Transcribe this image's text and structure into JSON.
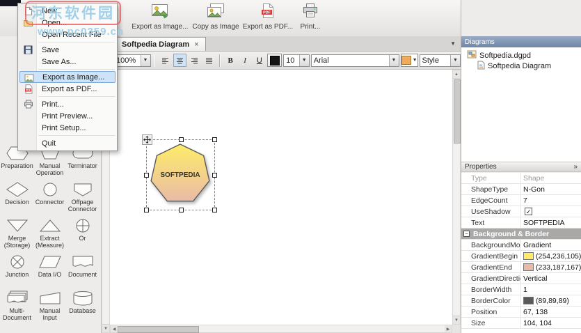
{
  "icons": {
    "dropdown_arrow": "▼",
    "close": "×",
    "check": "✓",
    "chevron_right": "»",
    "collapse": "−",
    "arrow_up": "▲",
    "arrow_down": "▼",
    "arrow_left": "◀",
    "arrow_right": "▶"
  },
  "watermark": {
    "line1": "河东软件园",
    "line2": "www.pc0359.cn"
  },
  "toolbar": {
    "buttons": [
      {
        "label": "Export as Image..."
      },
      {
        "label": "Copy as Image"
      },
      {
        "label": "Export as PDF..."
      },
      {
        "label": "Print..."
      }
    ]
  },
  "file_menu": {
    "items": [
      {
        "label": "New"
      },
      {
        "label": "Open..."
      },
      {
        "label": "Open Recent File"
      },
      {
        "label": "Save"
      },
      {
        "label": "Save As..."
      },
      {
        "label": "Export as Image..."
      },
      {
        "label": "Export as PDF..."
      },
      {
        "label": "Print..."
      },
      {
        "label": "Print Preview..."
      },
      {
        "label": "Print Setup..."
      },
      {
        "label": "Quit"
      }
    ]
  },
  "tabbar": {
    "active_tab": "Softpedia Diagram"
  },
  "format_toolbar": {
    "zoom_value": "100%",
    "bold_label": "B",
    "italic_label": "I",
    "underline_label": "U",
    "font_size_value": "10",
    "font_value": "Arial",
    "style_value": "Style"
  },
  "palette": {
    "items": [
      {
        "label": "Preparation",
        "shape": "preparation"
      },
      {
        "label": "Manual Operation",
        "shape": "manual-operation"
      },
      {
        "label": "Terminator",
        "shape": "terminator"
      },
      {
        "label": "Decision",
        "shape": "decision"
      },
      {
        "label": "Connector",
        "shape": "connector"
      },
      {
        "label": "Offpage Connector",
        "shape": "offpage-connector"
      },
      {
        "label": "Merge (Storage)",
        "shape": "merge-storage"
      },
      {
        "label": "Extract (Measure)",
        "shape": "extract-measure"
      },
      {
        "label": "Or",
        "shape": "or"
      },
      {
        "label": "Junction",
        "shape": "junction"
      },
      {
        "label": "Data I/O",
        "shape": "data-io"
      },
      {
        "label": "Document",
        "shape": "document"
      },
      {
        "label": "Multi-Document",
        "shape": "multi-document"
      },
      {
        "label": "Manual Input",
        "shape": "manual-input"
      },
      {
        "label": "Database",
        "shape": "database"
      }
    ]
  },
  "canvas": {
    "shape_label": "SOFTPEDIA",
    "gradient_begin": "#FEEC69",
    "gradient_end": "#E9BBA7",
    "border_color": "#595959"
  },
  "diagrams_panel": {
    "title": "Diagrams",
    "root_item": "Softpedia.dgpd",
    "child_item": "Softpedia Diagram"
  },
  "properties_panel": {
    "title": "Properties",
    "rows": [
      {
        "name": "Type",
        "value": "Shape",
        "dim": true
      },
      {
        "name": "ShapeType",
        "value": "N-Gon"
      },
      {
        "name": "EdgeCount",
        "value": "7"
      },
      {
        "name": "UseShadow",
        "type": "checkbox",
        "checked": true
      },
      {
        "name": "Text",
        "value": "SOFTPEDIA"
      },
      {
        "name": "Background & Border",
        "type": "section"
      },
      {
        "name": "BackgroundMode",
        "value": "Gradient"
      },
      {
        "name": "GradientBegin",
        "value": "(254,236,105)",
        "swatch": "#FEEC69"
      },
      {
        "name": "GradientEnd",
        "value": "(233,187,167)",
        "swatch": "#E9BBA7"
      },
      {
        "name": "GradientDirection",
        "value": "Vertical"
      },
      {
        "name": "BorderWidth",
        "value": "1"
      },
      {
        "name": "BorderColor",
        "value": "(89,89,89)",
        "swatch": "#595959"
      },
      {
        "name": "Position",
        "value": "67, 138"
      },
      {
        "name": "Size",
        "value": "104, 104"
      }
    ]
  }
}
